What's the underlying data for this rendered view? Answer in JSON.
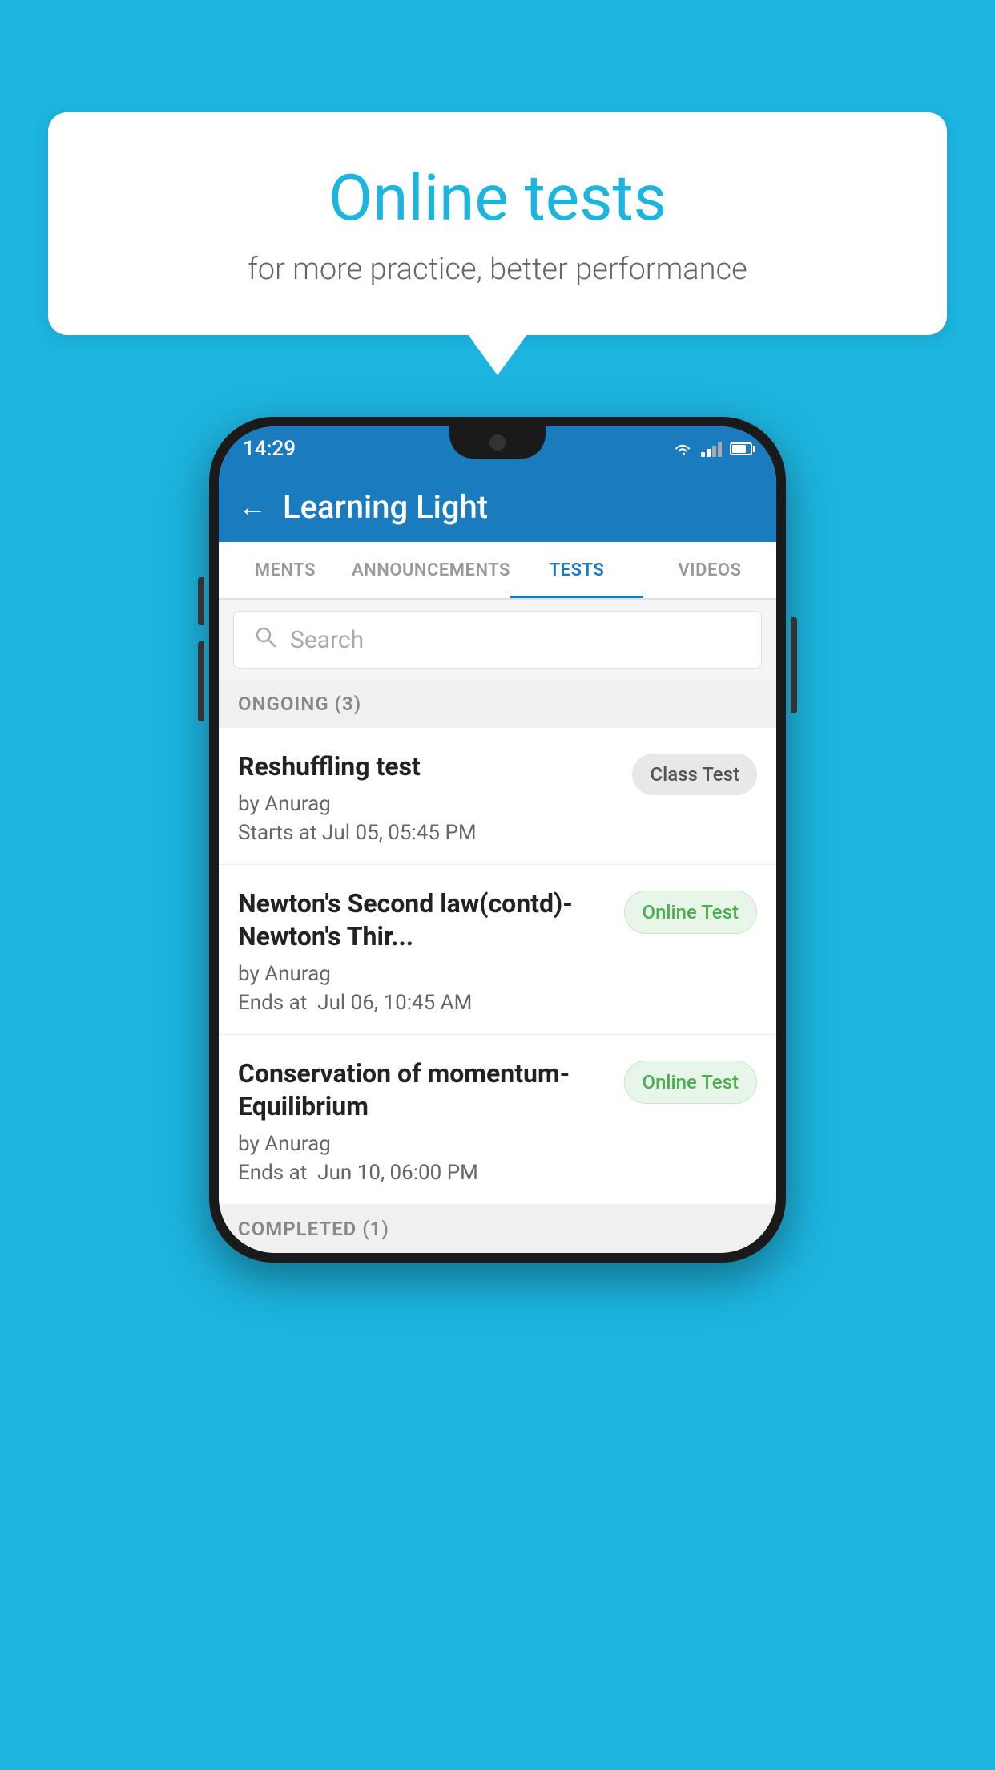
{
  "background_color": "#1db5e0",
  "bubble": {
    "title": "Online tests",
    "subtitle": "for more practice, better performance"
  },
  "phone": {
    "status_bar": {
      "time": "14:29",
      "icons": [
        "wifi",
        "signal",
        "battery"
      ]
    },
    "header": {
      "back_label": "←",
      "title": "Learning Light"
    },
    "tabs": [
      {
        "label": "MENTS",
        "active": false
      },
      {
        "label": "ANNOUNCEMENTS",
        "active": false
      },
      {
        "label": "TESTS",
        "active": true
      },
      {
        "label": "VIDEOS",
        "active": false
      }
    ],
    "search": {
      "placeholder": "Search"
    },
    "sections": [
      {
        "header": "ONGOING (3)",
        "items": [
          {
            "name": "Reshuffling test",
            "by": "by Anurag",
            "time_label": "Starts at",
            "time": "Jul 05, 05:45 PM",
            "badge": "Class Test",
            "badge_type": "class"
          },
          {
            "name": "Newton's Second law(contd)-Newton's Thir...",
            "by": "by Anurag",
            "time_label": "Ends at",
            "time": "Jul 06, 10:45 AM",
            "badge": "Online Test",
            "badge_type": "online"
          },
          {
            "name": "Conservation of momentum-Equilibrium",
            "by": "by Anurag",
            "time_label": "Ends at",
            "time": "Jun 10, 06:00 PM",
            "badge": "Online Test",
            "badge_type": "online"
          }
        ]
      },
      {
        "header": "COMPLETED (1)",
        "items": []
      }
    ]
  }
}
